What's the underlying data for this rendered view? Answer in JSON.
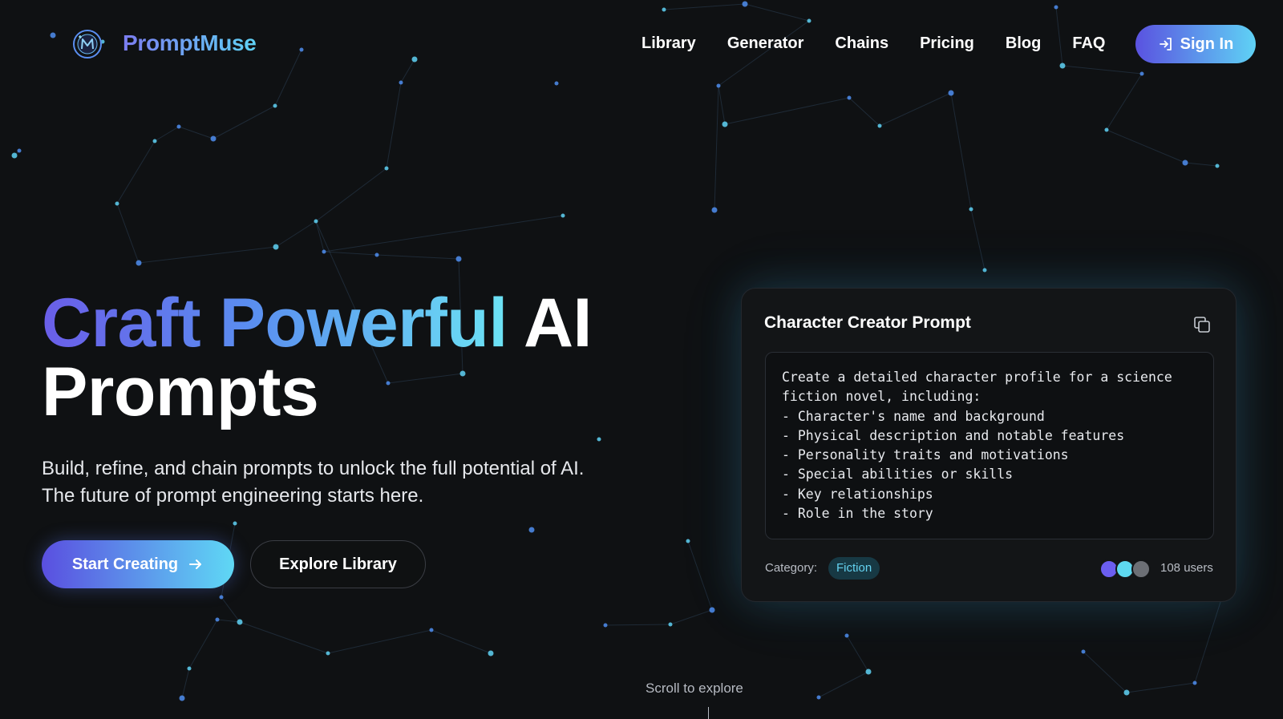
{
  "brand": {
    "name": "PromptMuse",
    "logo_icon": "muse-logo-icon"
  },
  "nav": {
    "links": [
      "Library",
      "Generator",
      "Chains",
      "Pricing",
      "Blog",
      "FAQ"
    ],
    "signin_label": "Sign In",
    "signin_icon": "login-arrow-icon"
  },
  "hero": {
    "title_gradient": "Craft Powerful",
    "title_white_1": "AI",
    "title_white_2": "Prompts",
    "subtitle": "Build, refine, and chain prompts to unlock the full potential of AI. The future of prompt engineering starts here.",
    "primary_button": "Start Creating",
    "secondary_button": "Explore Library"
  },
  "card": {
    "title": "Character Creator Prompt",
    "copy_icon": "copy-icon",
    "prompt_lines": [
      "Create a detailed character profile for a science",
      "fiction novel, including:",
      "- Character's name and background",
      "- Physical description and notable features",
      "- Personality traits and motivations",
      "- Special abilities or skills",
      "- Key relationships",
      "- Role in the story"
    ],
    "category_label": "Category:",
    "category_value": "Fiction",
    "users_count": "108 users"
  },
  "scroll_hint": "Scroll to explore",
  "colors": {
    "background": "#0f1113",
    "accent_purple": "#5a4fe0",
    "accent_cyan": "#5fd8f5",
    "card_bg": "#131517"
  }
}
